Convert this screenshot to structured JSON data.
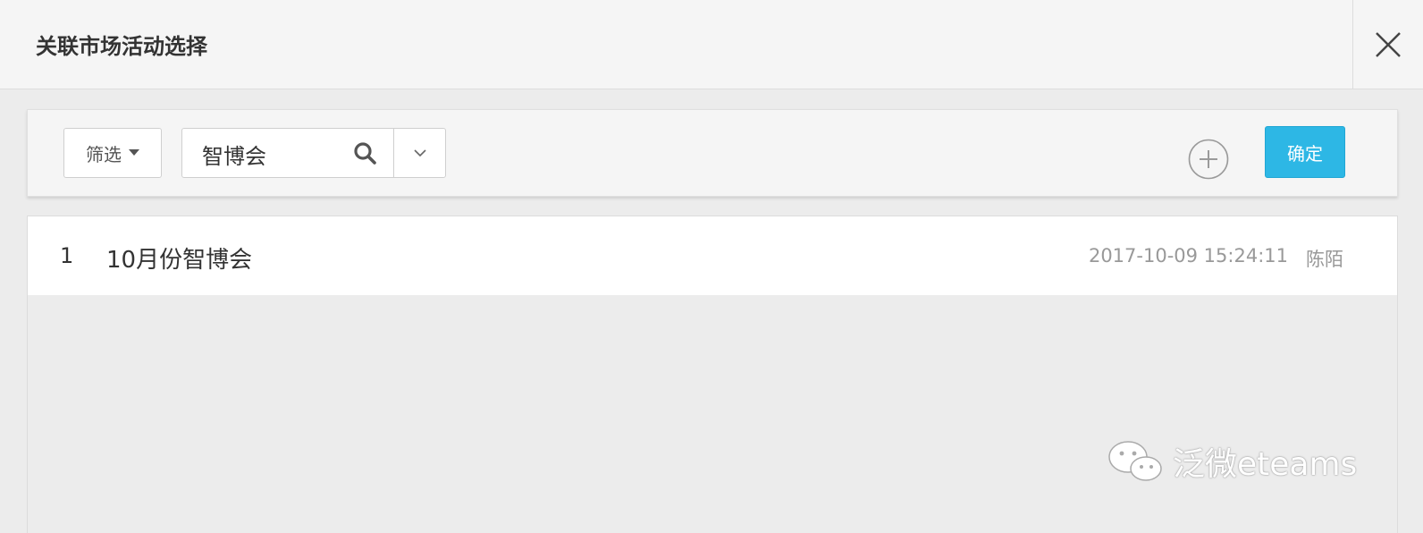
{
  "dialog": {
    "title": "关联市场活动选择",
    "close_icon": "close-icon"
  },
  "toolbar": {
    "filter_label": "筛选",
    "filter_icon": "caret-down-icon",
    "search_value": "智博会",
    "search_icon": "search-icon",
    "dropdown_icon": "chevron-down-icon",
    "add_icon": "plus-circle-icon",
    "confirm_label": "确定"
  },
  "list": {
    "rows": [
      {
        "index": "1",
        "name": "10月份智博会",
        "time": "2017-10-09 15:24:11",
        "user": "陈陌"
      }
    ]
  },
  "watermark": {
    "text": "泛微eteams",
    "icon": "wechat-icon"
  },
  "colors": {
    "accent": "#2db7e5",
    "header_bg": "#f5f5f5",
    "page_bg": "#ececec"
  }
}
